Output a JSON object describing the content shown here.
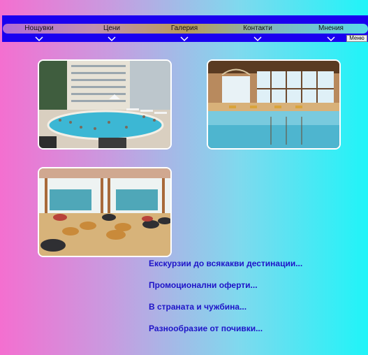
{
  "nav": {
    "items": [
      {
        "label": "Нощувки"
      },
      {
        "label": "Цени"
      },
      {
        "label": "Галерия"
      },
      {
        "label": "Контакти"
      },
      {
        "label": "Мнения"
      }
    ],
    "menu_button": "Меню"
  },
  "gallery": {
    "images": [
      {
        "icon": "hotel-pool-outdoor-image"
      },
      {
        "icon": "indoor-pool-image"
      },
      {
        "icon": "lounge-room-image"
      }
    ]
  },
  "promo_links": [
    {
      "label": "Екскурзии до всякакви дестинации..."
    },
    {
      "label": "Промоционални оферти..."
    },
    {
      "label": "В страната и чужбина..."
    },
    {
      "label": "Разнообразие от почивки..."
    }
  ],
  "colors": {
    "nav_background": "#1a00f0",
    "link": "#1f14c8"
  }
}
